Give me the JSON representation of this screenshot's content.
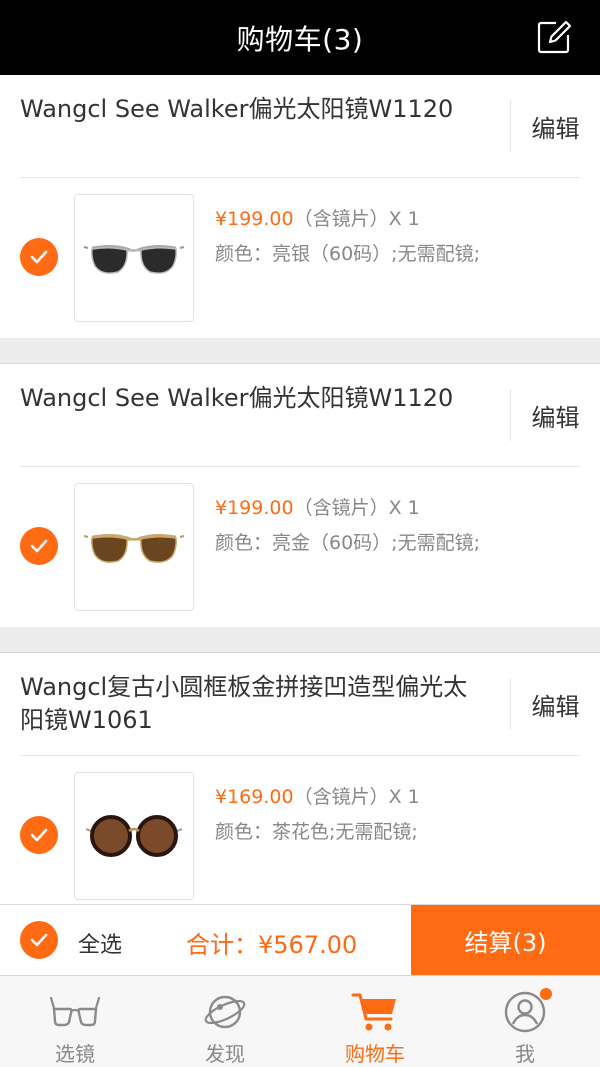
{
  "header": {
    "title": "购物车(3)",
    "edit_icon": "edit-icon"
  },
  "items": [
    {
      "title": "Wangcl See Walker偏光太阳镜W1120",
      "edit_label": "编辑",
      "checked": true,
      "price": "¥199.00",
      "lens_note": "（含镜片）",
      "qty": "X 1",
      "spec": "颜色：亮银（60码）;无需配镜;",
      "image": "aviator-sunglasses-silver"
    },
    {
      "title": "Wangcl See Walker偏光太阳镜W1120",
      "edit_label": "编辑",
      "checked": true,
      "price": "¥199.00",
      "lens_note": "（含镜片）",
      "qty": "X 1",
      "spec": "颜色：亮金（60码）;无需配镜;",
      "image": "aviator-sunglasses-gold"
    },
    {
      "title": "Wangcl复古小圆框板金拼接凹造型偏光太阳镜W1061",
      "edit_label": "编辑",
      "checked": true,
      "price": "¥169.00",
      "lens_note": "（含镜片）",
      "qty": "X 1",
      "spec": "颜色：茶花色;无需配镜;",
      "image": "round-sunglasses-tortoise"
    }
  ],
  "checkout": {
    "select_all_label": "全选",
    "total_label": "合计：",
    "total_value": "¥567.00",
    "pay_label": "结算(3)"
  },
  "tabbar": {
    "tabs": [
      {
        "label": "选镜",
        "icon": "glasses-icon",
        "active": false
      },
      {
        "label": "发现",
        "icon": "planet-icon",
        "active": false
      },
      {
        "label": "购物车",
        "icon": "cart-icon",
        "active": true
      },
      {
        "label": "我",
        "icon": "user-icon",
        "active": false,
        "badge": true
      }
    ]
  },
  "colors": {
    "accent": "#ff6a13",
    "header_bg": "#000000",
    "page_bg": "#ececec"
  }
}
